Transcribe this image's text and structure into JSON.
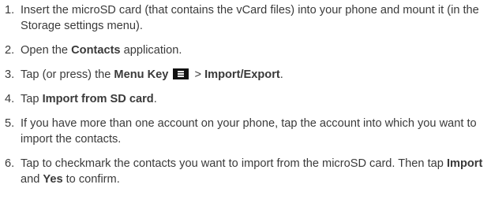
{
  "steps": [
    {
      "number": "1.",
      "text": "Insert the microSD card (that contains the vCard files) into your phone and mount it (in the Storage settings menu)."
    },
    {
      "number": "2.",
      "t1": "Open the ",
      "b1": "Contacts",
      "t2": " application."
    },
    {
      "number": "3.",
      "t1": "Tap (or press) the ",
      "b1": "Menu Key",
      "icon": "menu-key-icon",
      "t2": " > ",
      "b2": "Import/Export",
      "t3": "."
    },
    {
      "number": "4.",
      "t1": "Tap ",
      "b1": "Import from SD card",
      "t2": "."
    },
    {
      "number": "5.",
      "text": "If you have more than one account on your phone, tap the account into which you want to import the contacts."
    },
    {
      "number": "6.",
      "t1": "Tap to checkmark the contacts you want to import from the microSD card. Then tap ",
      "b1": "Import",
      "t2": " and ",
      "b2": "Yes",
      "t3": " to confirm."
    }
  ]
}
